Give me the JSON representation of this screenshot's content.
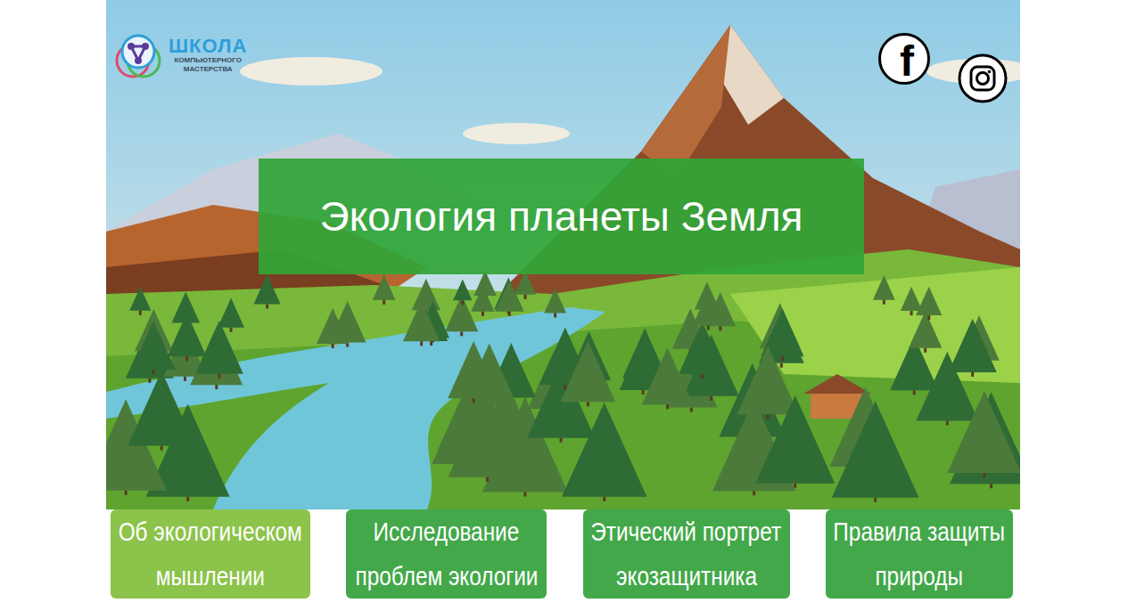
{
  "logo": {
    "title": "ШКОЛА",
    "subtitle_lines": [
      "КОМПЬЮТЕРНОГО",
      "МАСТЕРСТВА"
    ]
  },
  "social": {
    "facebook_glyph": "f"
  },
  "headline": "Экология планеты Земля",
  "nav": [
    {
      "lines": [
        "Об экологическом",
        "мышлении"
      ],
      "highlighted": true
    },
    {
      "lines": [
        "Исследование",
        "проблем экологии"
      ],
      "highlighted": false
    },
    {
      "lines": [
        "Этический портрет",
        "экозащитника"
      ],
      "highlighted": false
    },
    {
      "lines": [
        "Правила защиты",
        "природы"
      ],
      "highlighted": false
    }
  ]
}
